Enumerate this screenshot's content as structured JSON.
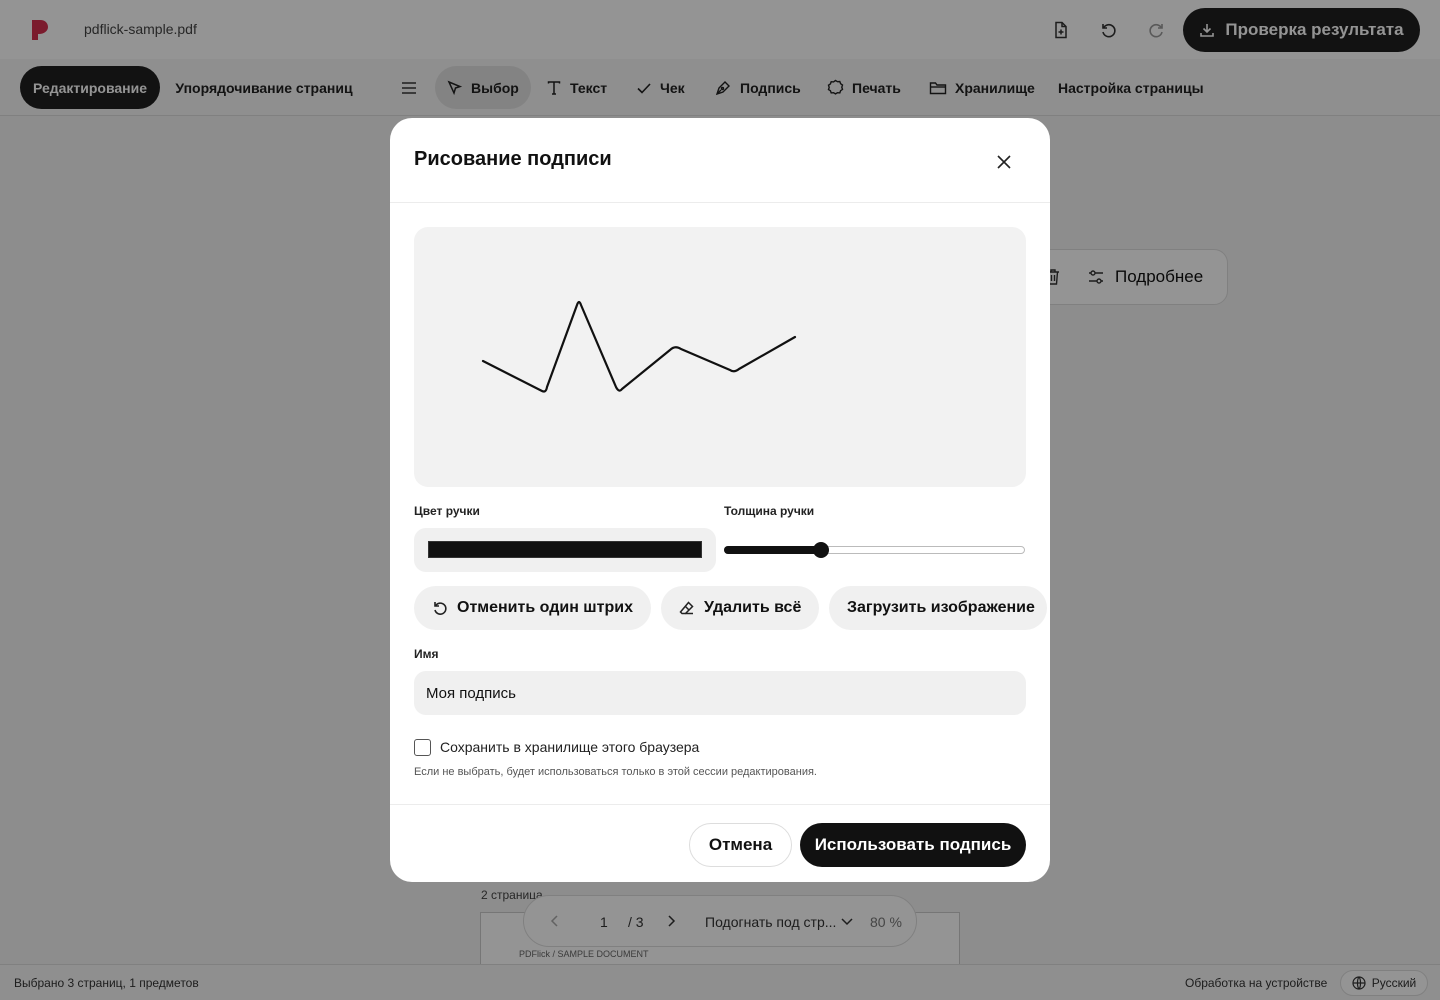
{
  "app": {
    "filename": "pdflick-sample.pdf",
    "check_button": "Проверка результата"
  },
  "toolbar": {
    "modes": [
      "Редактирование",
      "Упорядочивание страниц"
    ],
    "tools": {
      "select": "Выбор",
      "text": "Текст",
      "check": "Чек",
      "signature": "Подпись",
      "stamp": "Печать",
      "storage": "Хранилище",
      "page_setup": "Настройка страницы"
    }
  },
  "document": {
    "more_button": "Подробнее",
    "page_label": "2 страница",
    "page_header": "PDFlick / SAMPLE DOCUMENT"
  },
  "pager": {
    "current_page": "1",
    "total_pages": "/ 3",
    "fit_mode": "Подогнать под стр...",
    "zoom": "80 %"
  },
  "status": {
    "selection": "Выбрано 3 страниц, 1 предметов",
    "processing": "Обработка на устройстве",
    "language": "Русский"
  },
  "modal": {
    "title": "Рисование подписи",
    "pen_color_label": "Цвет ручки",
    "pen_color": "#111111",
    "pen_width_label": "Толщина ручки",
    "pen_width_level": 0.31,
    "undo_stroke": "Отменить один штрих",
    "clear_all": "Удалить всё",
    "upload_image": "Загрузить изображение",
    "name_label": "Имя",
    "name_value": "Моя подпись",
    "save_label": "Сохранить в хранилище этого браузера",
    "save_checked": false,
    "hint": "Если не выбрать, будет использоваться только в этой сессии редактирования.",
    "cancel": "Отмена",
    "use": "Использовать подпись"
  },
  "colors": {
    "accent_dark": "#1f1f1f",
    "logo": "#d4304e"
  }
}
